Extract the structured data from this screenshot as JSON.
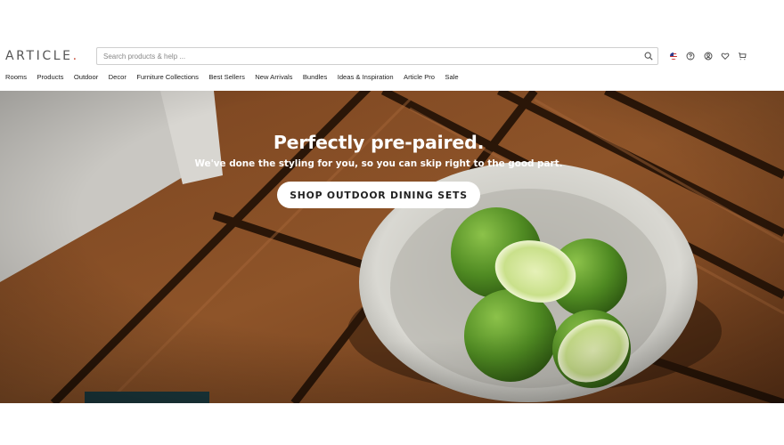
{
  "header": {
    "logo_text": "ARTICLE",
    "logo_dot": ".",
    "search": {
      "placeholder": "Search products & help ..."
    },
    "utility_icons": [
      "us-flag-icon",
      "help-icon",
      "account-icon",
      "wishlist-heart-icon",
      "cart-icon"
    ]
  },
  "nav": {
    "items": [
      "Rooms",
      "Products",
      "Outdoor",
      "Decor",
      "Furniture Collections",
      "Best Sellers",
      "New Arrivals",
      "Bundles",
      "Ideas & Inspiration",
      "Article Pro",
      "Sale"
    ]
  },
  "hero": {
    "title": "Perfectly pre-paired.",
    "subtitle": "We've done the styling for you, so you can skip right to the good part.",
    "cta_label": "SHOP OUTDOOR DINING SETS"
  },
  "colors": {
    "logo": "#555555",
    "logo_dot": "#c8503a",
    "wood": "#8a5128",
    "lime": "#5f9a2c",
    "cta_bg": "#ffffff"
  }
}
